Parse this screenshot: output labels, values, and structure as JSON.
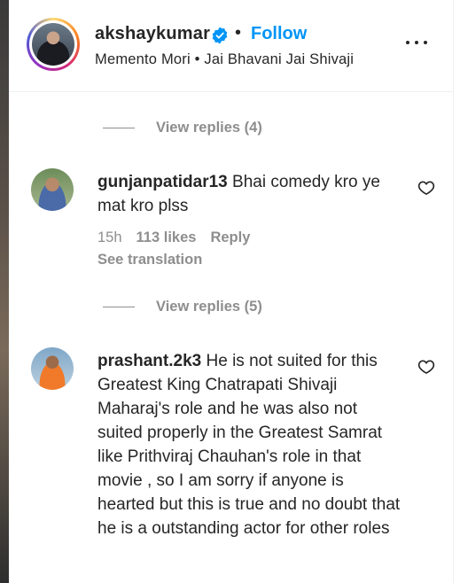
{
  "header": {
    "username": "akshaykumar",
    "follow_label": "Follow",
    "separator": "•",
    "audio": "Memento Mori • Jai Bhavani Jai Shivaji"
  },
  "replies": [
    {
      "label": "View replies (4)"
    },
    {
      "label": "View replies (5)"
    }
  ],
  "comments": [
    {
      "username": "gunjanpatidar13",
      "text": "Bhai comedy kro ye mat kro plss",
      "time": "15h",
      "likes": "113 likes",
      "reply": "Reply",
      "translate": "See translation"
    },
    {
      "username": "prashant.2k3",
      "text": "He is not suited for this Greatest King Chatrapati Shivaji Maharaj's role and he was also not suited properly in the Greatest Samrat like Prithviraj Chauhan's role in that movie , so I am sorry if anyone is hearted but this is true and no doubt that he is a outstanding actor for other roles"
    }
  ],
  "icons": {
    "verified": "verified-badge-icon",
    "more": "more-options-icon",
    "heart": "heart-outline-icon"
  },
  "colors": {
    "accent": "#0095f6",
    "muted": "#8e8e8e",
    "text": "#262626"
  }
}
